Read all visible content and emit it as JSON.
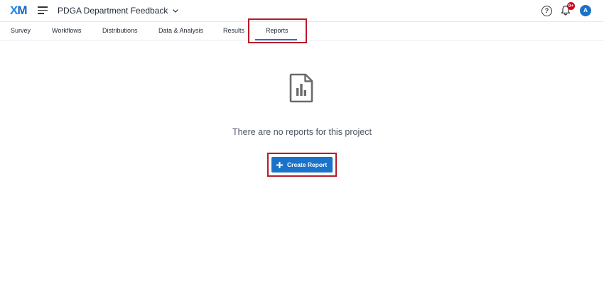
{
  "app": {
    "logo": {
      "x": "X",
      "m": "M"
    },
    "project_title": "PDGA Department Feedback",
    "help_symbol": "?",
    "notification_count": "9+",
    "avatar_initial": "A"
  },
  "tabs": [
    {
      "label": "Survey"
    },
    {
      "label": "Workflows"
    },
    {
      "label": "Distributions"
    },
    {
      "label": "Data & Analysis"
    },
    {
      "label": "Results"
    },
    {
      "label": "Reports",
      "active": true
    }
  ],
  "empty_state": {
    "icon": "report-chart-icon",
    "message": "There are no reports for this project",
    "create_button_label": "Create Report"
  },
  "colors": {
    "accent": "#1a73c9",
    "highlight": "#b81b28",
    "badge": "#d0021b"
  },
  "icons": {
    "menu": "hamburger-menu-icon",
    "help": "help-circle-icon",
    "notifications": "bell-icon",
    "dropdown": "chevron-down-icon",
    "create": "plus-icon"
  }
}
